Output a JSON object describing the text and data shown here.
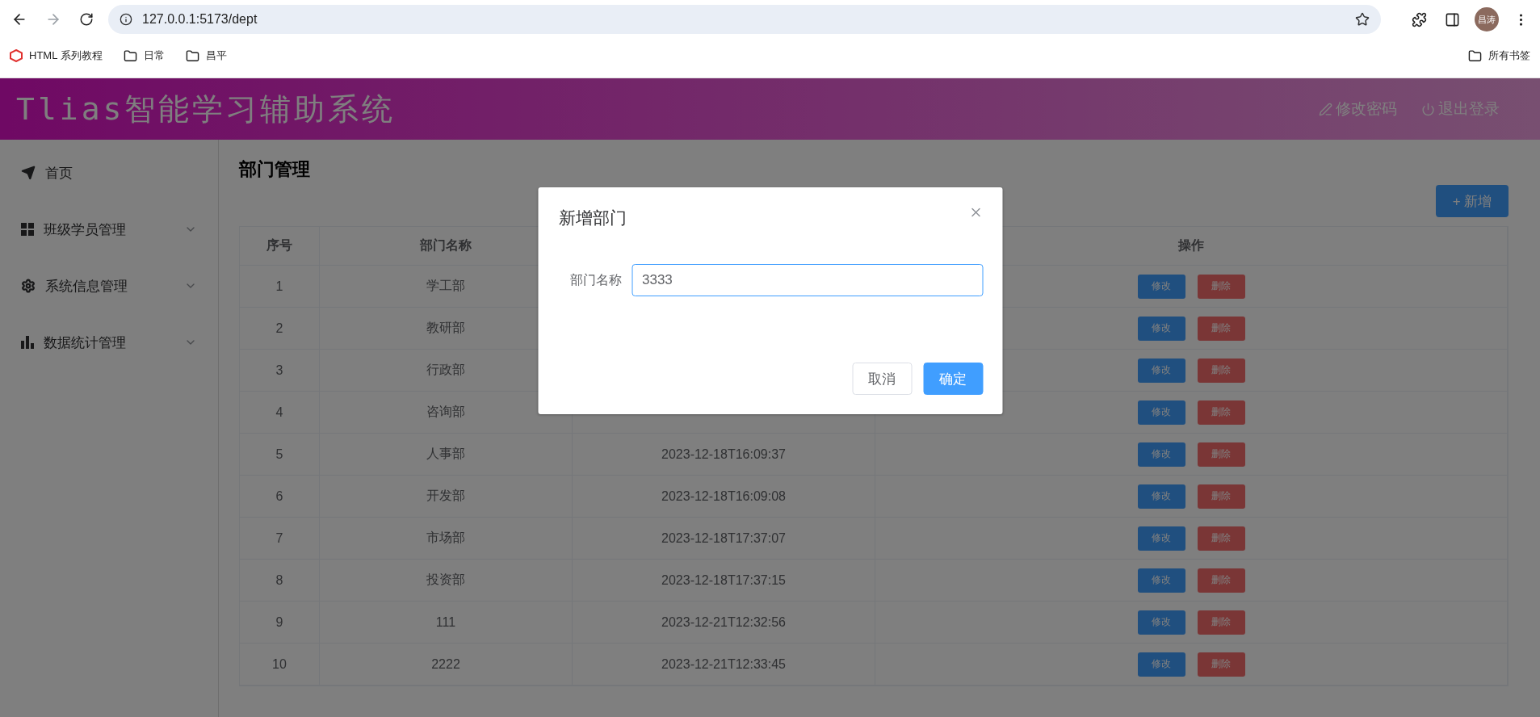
{
  "browser": {
    "address": "127.0.0.1:5173/dept",
    "avatar_text": "昌涛",
    "bookmarks": [
      {
        "label": "HTML 系列教程",
        "kind": "site"
      },
      {
        "label": "日常",
        "kind": "folder"
      },
      {
        "label": "昌平",
        "kind": "folder"
      }
    ],
    "all_bookmarks": "所有书签"
  },
  "header": {
    "title": "Tlias智能学习辅助系统",
    "actions": [
      {
        "label": "修改密码",
        "kind": "edit"
      },
      {
        "label": "退出登录",
        "kind": "power"
      }
    ]
  },
  "sidebar": {
    "items": [
      {
        "label": "首页",
        "expandable": false
      },
      {
        "label": "班级学员管理",
        "expandable": true
      },
      {
        "label": "系统信息管理",
        "expandable": true
      },
      {
        "label": "数据统计管理",
        "expandable": true
      }
    ]
  },
  "page": {
    "title": "部门管理",
    "add_button": "+ 新增",
    "table": {
      "columns": {
        "index": "序号",
        "name": "部门名称",
        "actions": "操作"
      },
      "rows": [
        {
          "index": "1",
          "name": "学工部",
          "edit": "修改",
          "delete": "删除"
        },
        {
          "index": "2",
          "name": "教研部",
          "edit": "修改",
          "delete": "删除"
        },
        {
          "index": "3",
          "name": "行政部",
          "edit": "修改",
          "delete": "删除"
        },
        {
          "index": "4",
          "name": "咨询部",
          "edit": "修改",
          "delete": "删除"
        },
        {
          "index": "5",
          "name": "人事部",
          "time": "2023-12-18T16:09:37",
          "edit": "修改",
          "delete": "删除"
        },
        {
          "index": "6",
          "name": "开发部",
          "time": "2023-12-18T16:09:08",
          "edit": "修改",
          "delete": "删除"
        },
        {
          "index": "7",
          "name": "市场部",
          "time": "2023-12-18T17:37:07",
          "edit": "修改",
          "delete": "删除"
        },
        {
          "index": "8",
          "name": "投资部",
          "time": "2023-12-18T17:37:15",
          "edit": "修改",
          "delete": "删除"
        },
        {
          "index": "9",
          "name": "111",
          "time": "2023-12-21T12:32:56",
          "edit": "修改",
          "delete": "删除"
        },
        {
          "index": "10",
          "name": "2222",
          "time": "2023-12-21T12:33:45",
          "edit": "修改",
          "delete": "删除"
        }
      ]
    }
  },
  "dialog": {
    "title": "新增部门",
    "field_label": "部门名称",
    "field_value": "3333",
    "buttons": [
      {
        "label": "取消",
        "kind": "default"
      },
      {
        "label": "确定",
        "kind": "primary"
      }
    ]
  }
}
